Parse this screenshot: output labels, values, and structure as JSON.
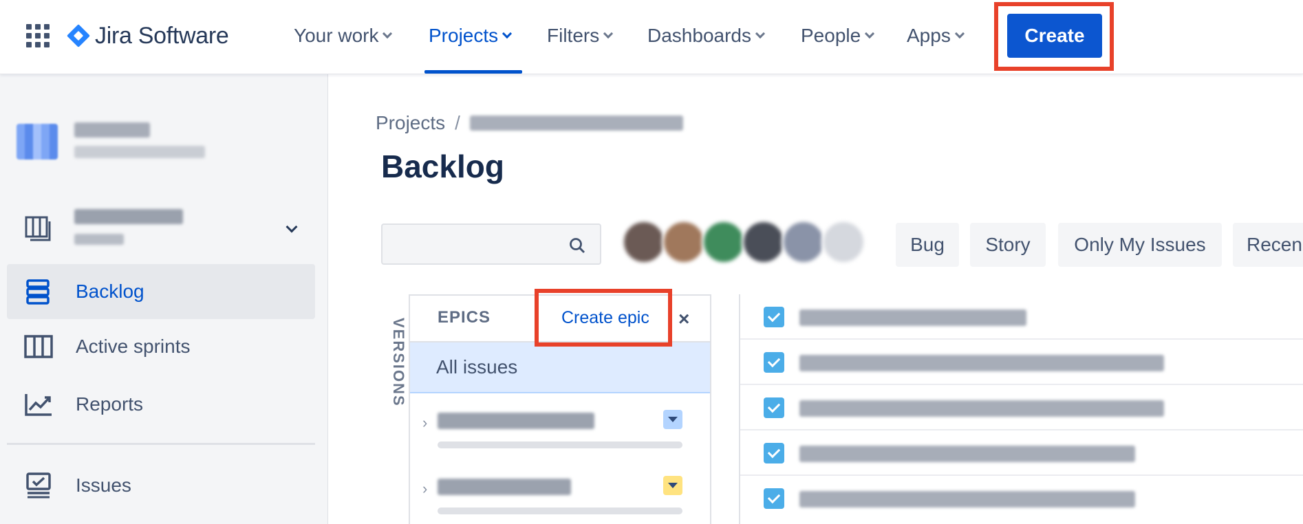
{
  "nav": {
    "app_name": "Jira Software",
    "items": [
      {
        "label": "Your work",
        "active": false
      },
      {
        "label": "Projects",
        "active": true
      },
      {
        "label": "Filters",
        "active": false
      },
      {
        "label": "Dashboards",
        "active": false
      },
      {
        "label": "People",
        "active": false
      },
      {
        "label": "Apps",
        "active": false
      }
    ],
    "create_label": "Create",
    "accent_color": "#0052cc",
    "highlight_color": "#e8412a"
  },
  "sidebar": {
    "items": [
      {
        "label": "Backlog",
        "icon": "backlog-icon",
        "active": true
      },
      {
        "label": "Active sprints",
        "icon": "board-columns-icon",
        "active": false
      },
      {
        "label": "Reports",
        "icon": "chart-line-icon",
        "active": false
      },
      {
        "label": "Issues",
        "icon": "issues-icon",
        "active": false
      }
    ]
  },
  "main": {
    "breadcrumb_root": "Projects",
    "breadcrumb_sep": "/",
    "title": "Backlog",
    "search_placeholder": "",
    "quick_filters": [
      "Bug",
      "Story",
      "Only My Issues",
      "Recen"
    ]
  },
  "epics": {
    "versions_tab": "VERSIONS",
    "header": "EPICS",
    "create_epic_label": "Create epic",
    "close_glyph": "×",
    "all_issues_label": "All issues",
    "epic_colors": [
      "#b3d4ff",
      "#ffe380"
    ]
  },
  "issues": {
    "type_color": "#4bade8"
  }
}
